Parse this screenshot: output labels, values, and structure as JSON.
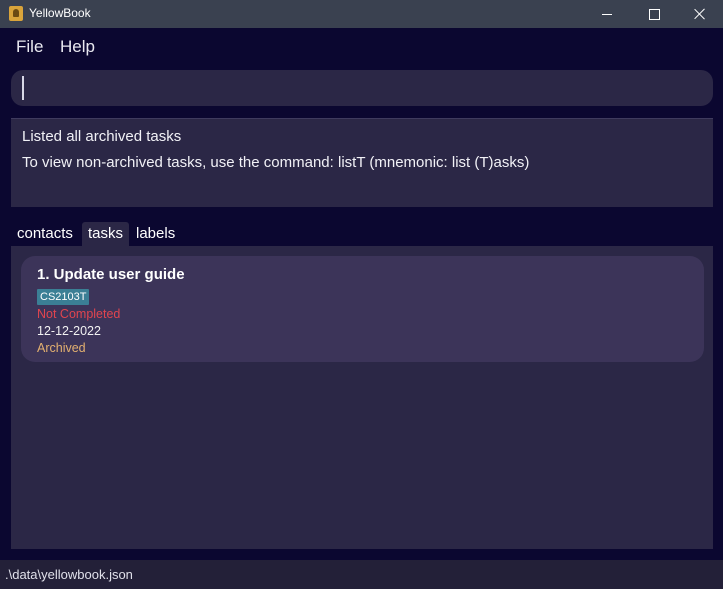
{
  "window": {
    "title": "YellowBook"
  },
  "menu": {
    "file": "File",
    "help": "Help"
  },
  "command_box": {
    "value": ""
  },
  "result": {
    "line1": "Listed all archived tasks",
    "line2": "To view non-archived tasks, use the command: listT (mnemonic: list (T)asks)"
  },
  "tabs": [
    {
      "label": "contacts",
      "selected": false
    },
    {
      "label": "tasks",
      "selected": true
    },
    {
      "label": "labels",
      "selected": false
    }
  ],
  "tasks": [
    {
      "title": "1.  Update user guide",
      "label": "CS2103T",
      "status": "Not Completed",
      "date": "12-12-2022",
      "archived": "Archived"
    }
  ],
  "status_bar": {
    "path": ".\\data\\yellowbook.json"
  },
  "colors": {
    "not_completed": "#e0454f",
    "archived": "#e3b070",
    "label_bg": "#3b7f95"
  }
}
